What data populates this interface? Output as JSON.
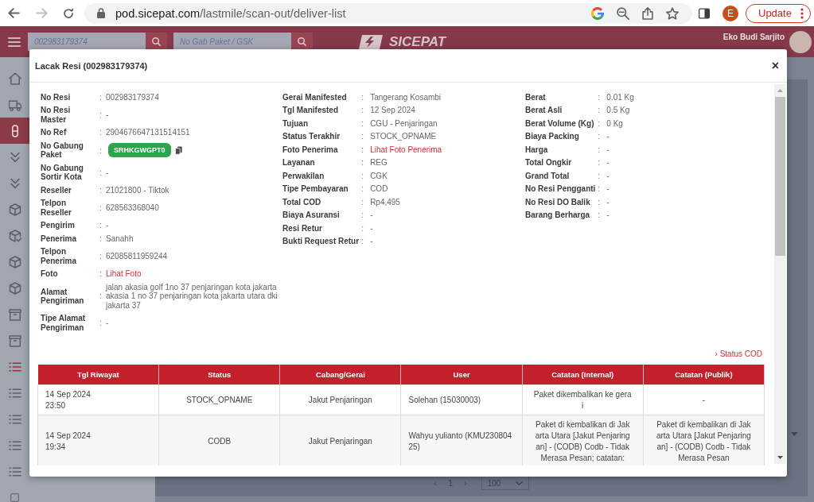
{
  "browser": {
    "url_host": "pod.sicepat.com",
    "url_path": "/lastmile/scan-out/deliver-list",
    "profile_initial": "E",
    "update_label": "Update"
  },
  "header": {
    "resi_search": {
      "value": "002983179374"
    },
    "gabung_search": {
      "placeholder": "No Gab Paket / GSK"
    },
    "logo_text": "SICEPAT",
    "user_name": "Eko Budi Sarjito"
  },
  "sidebar": {
    "items": [
      {
        "kind": "home",
        "selected": false,
        "highlighted": false
      },
      {
        "kind": "truck",
        "selected": false,
        "highlighted": false
      },
      {
        "kind": "capsule",
        "selected": true,
        "highlighted": false
      },
      {
        "kind": "chevrons",
        "selected": false,
        "highlighted": false
      },
      {
        "kind": "chevrons",
        "selected": false,
        "highlighted": false
      },
      {
        "kind": "cube",
        "selected": false,
        "highlighted": false
      },
      {
        "kind": "cubecheck",
        "selected": false,
        "highlighted": false
      },
      {
        "kind": "cube",
        "selected": false,
        "highlighted": false
      },
      {
        "kind": "cube",
        "selected": false,
        "highlighted": false
      },
      {
        "kind": "package",
        "selected": false,
        "highlighted": false
      },
      {
        "kind": "package",
        "selected": false,
        "highlighted": false
      },
      {
        "kind": "list",
        "selected": false,
        "highlighted": true
      },
      {
        "kind": "list",
        "selected": false,
        "highlighted": false
      },
      {
        "kind": "list",
        "selected": false,
        "highlighted": false
      },
      {
        "kind": "list",
        "selected": false,
        "highlighted": false
      },
      {
        "kind": "list",
        "selected": false,
        "highlighted": false
      },
      {
        "kind": "square",
        "selected": false,
        "highlighted": false
      }
    ]
  },
  "pagination": {
    "prev": "‹",
    "page": "1",
    "next": "›",
    "page_size": "100"
  },
  "modal": {
    "title": "Lacak Resi (002983179374)",
    "close": "×",
    "details": [
      {
        "rows": [
          {
            "label": "No Resi",
            "sep": ":",
            "value": "002983179374",
            "kind": "text"
          },
          {
            "label": "No Resi Master",
            "sep": ":",
            "value": "-",
            "kind": "text"
          },
          {
            "label": "No Ref",
            "sep": ":",
            "value": "2904676647131514151",
            "kind": "text"
          },
          {
            "label": "No Gabung Paket",
            "sep": ":",
            "value": "SRHKGWGPT0",
            "kind": "badge"
          },
          {
            "label": "No Gabung Sortir Kota",
            "sep": ":",
            "value": "-",
            "kind": "text"
          },
          {
            "label": "Reseller",
            "sep": ":",
            "value": "21021800 - Tiktok",
            "kind": "text"
          },
          {
            "label": "Telpon Reseller",
            "sep": ":",
            "value": "628563368040",
            "kind": "text"
          },
          {
            "label": "Pengirim",
            "sep": ":",
            "value": "-",
            "kind": "text"
          },
          {
            "label": "Penerima",
            "sep": ":",
            "value": "Sanahh",
            "kind": "text"
          },
          {
            "label": "Telpon Penerima",
            "sep": ":",
            "value": "62085811959244",
            "kind": "text"
          },
          {
            "label": "Foto",
            "sep": ":",
            "value": "Lihat Foto",
            "kind": "link"
          },
          {
            "label": "Alamat Pengiriman",
            "sep": ":",
            "value": "jalan akasia golf 1no 37 penjaringan kota jakarta akasia 1 no 37 penjaringan kota jakarta utara dki jakarta 37",
            "kind": "text"
          },
          {
            "label": "Tipe Alamat Pengiriman",
            "sep": ":",
            "value": "-",
            "kind": "text"
          }
        ]
      },
      {
        "rows": [
          {
            "label": "Gerai Manifested",
            "sep": ":",
            "value": "Tangerang Kosambi",
            "kind": "text"
          },
          {
            "label": "Tgl Manifested",
            "sep": ":",
            "value": "12 Sep 2024",
            "kind": "text"
          },
          {
            "label": "Tujuan",
            "sep": ":",
            "value": "CGU - Penjaringan",
            "kind": "text"
          },
          {
            "label": "Status Terakhir",
            "sep": ":",
            "value": "STOCK_OPNAME",
            "kind": "text"
          },
          {
            "label": "Foto Penerima",
            "sep": ":",
            "value": "Lihat Foto Penerima",
            "kind": "link"
          },
          {
            "label": "Layanan",
            "sep": ":",
            "value": "REG",
            "kind": "text"
          },
          {
            "label": "Perwakilan",
            "sep": ":",
            "value": "CGK",
            "kind": "text"
          },
          {
            "label": "Tipe Pembayaran",
            "sep": ":",
            "value": "COD",
            "kind": "text"
          },
          {
            "label": "Total COD",
            "sep": ":",
            "value": "Rp4,495",
            "kind": "text"
          },
          {
            "label": "Biaya Asuransi",
            "sep": ":",
            "value": "-",
            "kind": "text"
          },
          {
            "label": "Resi Retur",
            "sep": ":",
            "value": "-",
            "kind": "text"
          },
          {
            "label": "Bukti Request Retur",
            "sep": ":",
            "value": "-",
            "kind": "text"
          }
        ]
      },
      {
        "rows": [
          {
            "label": "Berat",
            "sep": ":",
            "value": "0.01 Kg",
            "kind": "text"
          },
          {
            "label": "Berat Asli",
            "sep": ":",
            "value": "0.5 Kg",
            "kind": "text"
          },
          {
            "label": "Berat Volume (Kg)",
            "sep": ":",
            "value": "0 Kg",
            "kind": "text"
          },
          {
            "label": "Biaya Packing",
            "sep": ":",
            "value": "-",
            "kind": "text"
          },
          {
            "label": "Harga",
            "sep": ":",
            "value": "-",
            "kind": "text"
          },
          {
            "label": "Total Ongkir",
            "sep": ":",
            "value": "-",
            "kind": "text"
          },
          {
            "label": "Grand Total",
            "sep": ":",
            "value": "-",
            "kind": "text"
          },
          {
            "label": "No Resi Pengganti",
            "sep": ":",
            "value": "-",
            "kind": "text"
          },
          {
            "label": "No Resi DO Balik",
            "sep": ":",
            "value": "-",
            "kind": "text"
          },
          {
            "label": "Barang Berharga",
            "sep": ":",
            "value": "-",
            "kind": "text"
          }
        ]
      }
    ],
    "status_cod_link": "› Status COD",
    "history": {
      "columns": [
        "Tgl Riwayat",
        "Status",
        "Cabang/Gerai",
        "User",
        "Catatan (Internal)",
        "Catatan (Publik)"
      ],
      "rows": [
        {
          "date": "14 Sep 2024",
          "time": "23:50",
          "status": "STOCK_OPNAME",
          "branch": "Jakut Penjaringan",
          "user": "Solehan (15030003)",
          "note_internal": "Paket dikembalikan ke gerai",
          "note_public": "-"
        },
        {
          "date": "14 Sep 2024",
          "time": "19:34",
          "status": "CODB",
          "branch": "Jakut Penjaringan",
          "user": "Wahyu yulianto (KMU23080425)",
          "note_internal": "Paket di kembalikan di Jakarta Utara [Jakut Penjaringan] - (CODB) Codb - Tidak Merasa Pesan; catatan:",
          "note_public": "Paket di kembalikan di Jakarta Utara [Jakut Penjaringan] - (CODB) Codb - Tidak Merasa Pesan"
        }
      ]
    }
  }
}
